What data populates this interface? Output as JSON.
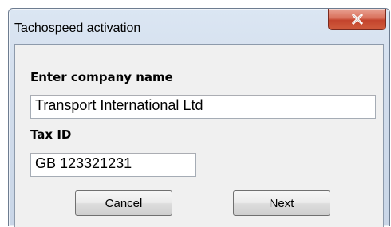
{
  "window": {
    "title": "Tachospeed activation",
    "close_icon": "close-x-icon"
  },
  "form": {
    "company_label": "Enter company name",
    "company_value": "Transport International Ltd",
    "tax_label": "Tax ID",
    "tax_value": "GB 123321231"
  },
  "buttons": {
    "cancel_label": "Cancel",
    "next_label": "Next"
  },
  "colors": {
    "close_button": "#c4442d",
    "dialog_background": "#f0f0f0",
    "frame": "#d2ddec"
  }
}
